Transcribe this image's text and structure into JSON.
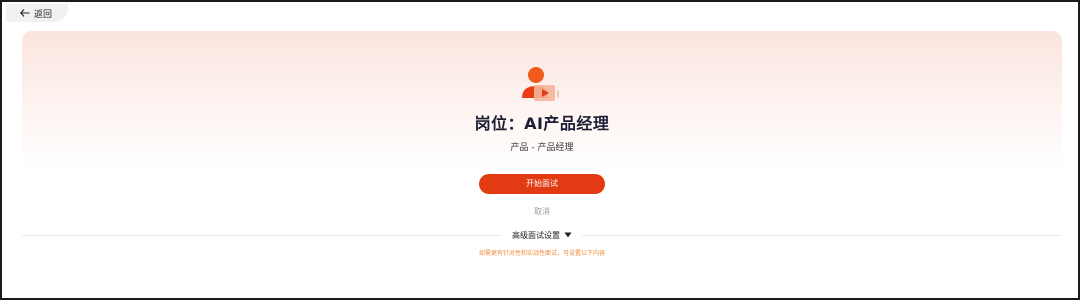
{
  "nav": {
    "back_label": "返回",
    "back_icon": "arrow-left-icon"
  },
  "job": {
    "title": "岗位：AI产品经理",
    "category": "产品 - 产品经理",
    "icon": "interviewer-video-icon"
  },
  "actions": {
    "start_label": "开始面试",
    "cancel_label": "取消"
  },
  "advanced": {
    "label": "高级面试设置",
    "toggle_icon": "caret-down-icon",
    "hint": "如需更有针对性和实战性面试，可设置以下内容"
  },
  "colors": {
    "accent": "#e23a12",
    "hint": "#f08a3a",
    "panel_top": "#fbe4de",
    "title": "#1d1d35"
  }
}
